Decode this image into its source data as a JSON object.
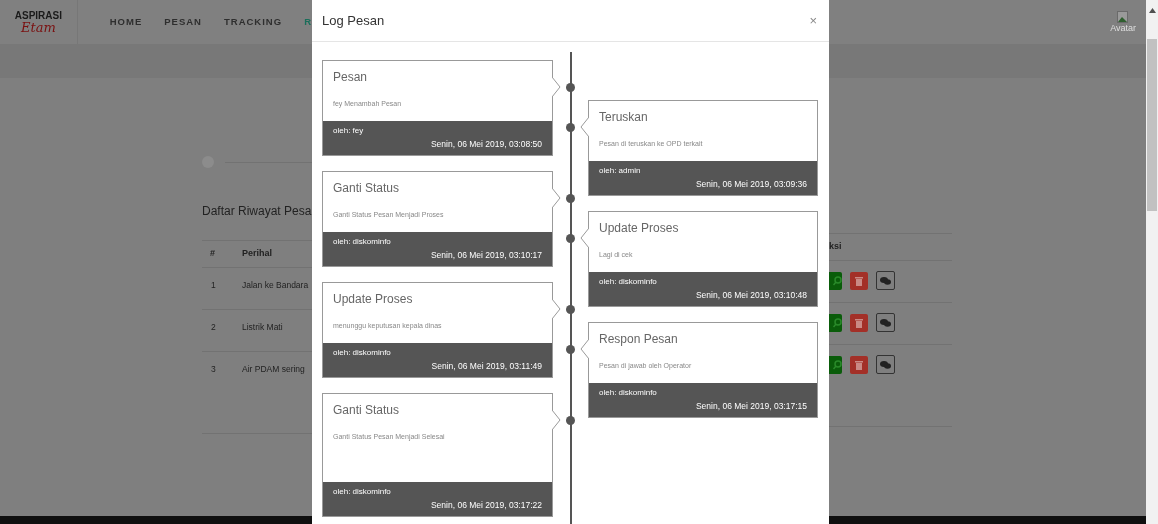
{
  "navbar": {
    "logo": {
      "top": "ASPIRASI",
      "bottom": "Etam"
    },
    "menu": [
      {
        "label": "HOME",
        "selected": false
      },
      {
        "label": "PESAN",
        "selected": false
      },
      {
        "label": "TRACKING",
        "selected": false
      },
      {
        "label": "R",
        "selected": true
      }
    ],
    "avatar": {
      "alt": "Avatar"
    }
  },
  "page": {
    "heading": "Daftar Riwayat Pesa",
    "table": {
      "columns": [
        "#",
        "Perihal",
        "ksi"
      ],
      "rows": [
        {
          "no": "1",
          "perihal": "Jalan ke Bandara"
        },
        {
          "no": "2",
          "perihal": "Listrik Mati"
        },
        {
          "no": "3",
          "perihal": "Air PDAM sering"
        }
      ]
    }
  },
  "modal": {
    "title": "Log Pesan",
    "close": "×",
    "entries": [
      {
        "kind": "left",
        "title": "Pesan",
        "text": "fey Menambah Pesan",
        "by": "oleh: fey",
        "date": "Senin, 06 Mei 2019, 03:08:50"
      },
      {
        "kind": "right",
        "title": "Teruskan",
        "text": "Pesan di teruskan ke OPD terkait",
        "by": "oleh: admin",
        "date": "Senin, 06 Mei 2019, 03:09:36"
      },
      {
        "kind": "left",
        "title": "Ganti Status",
        "text": "Ganti Status Pesan Menjadi Proses",
        "by": "oleh: diskominfo",
        "date": "Senin, 06 Mei 2019, 03:10:17"
      },
      {
        "kind": "right",
        "title": "Update Proses",
        "text": "Lagi di cek",
        "by": "oleh: diskominfo",
        "date": "Senin, 06 Mei 2019, 03:10:48"
      },
      {
        "kind": "left",
        "title": "Update Proses",
        "text": "menunggu keputusan kepala dinas",
        "by": "oleh: diskominfo",
        "date": "Senin, 06 Mei 2019, 03:11:49"
      },
      {
        "kind": "right",
        "title": "Respon Pesan",
        "text": "Pesan di jawab oleh Operator",
        "by": "oleh: diskominfo",
        "date": "Senin, 06 Mei 2019, 03:17:15"
      },
      {
        "kind": "left",
        "title": "Ganti Status",
        "text": "Ganti Status Pesan Menjadi Selesai",
        "by": "oleh: diskominfo",
        "date": "Senin, 06 Mei 2019, 03:17:22"
      }
    ]
  }
}
